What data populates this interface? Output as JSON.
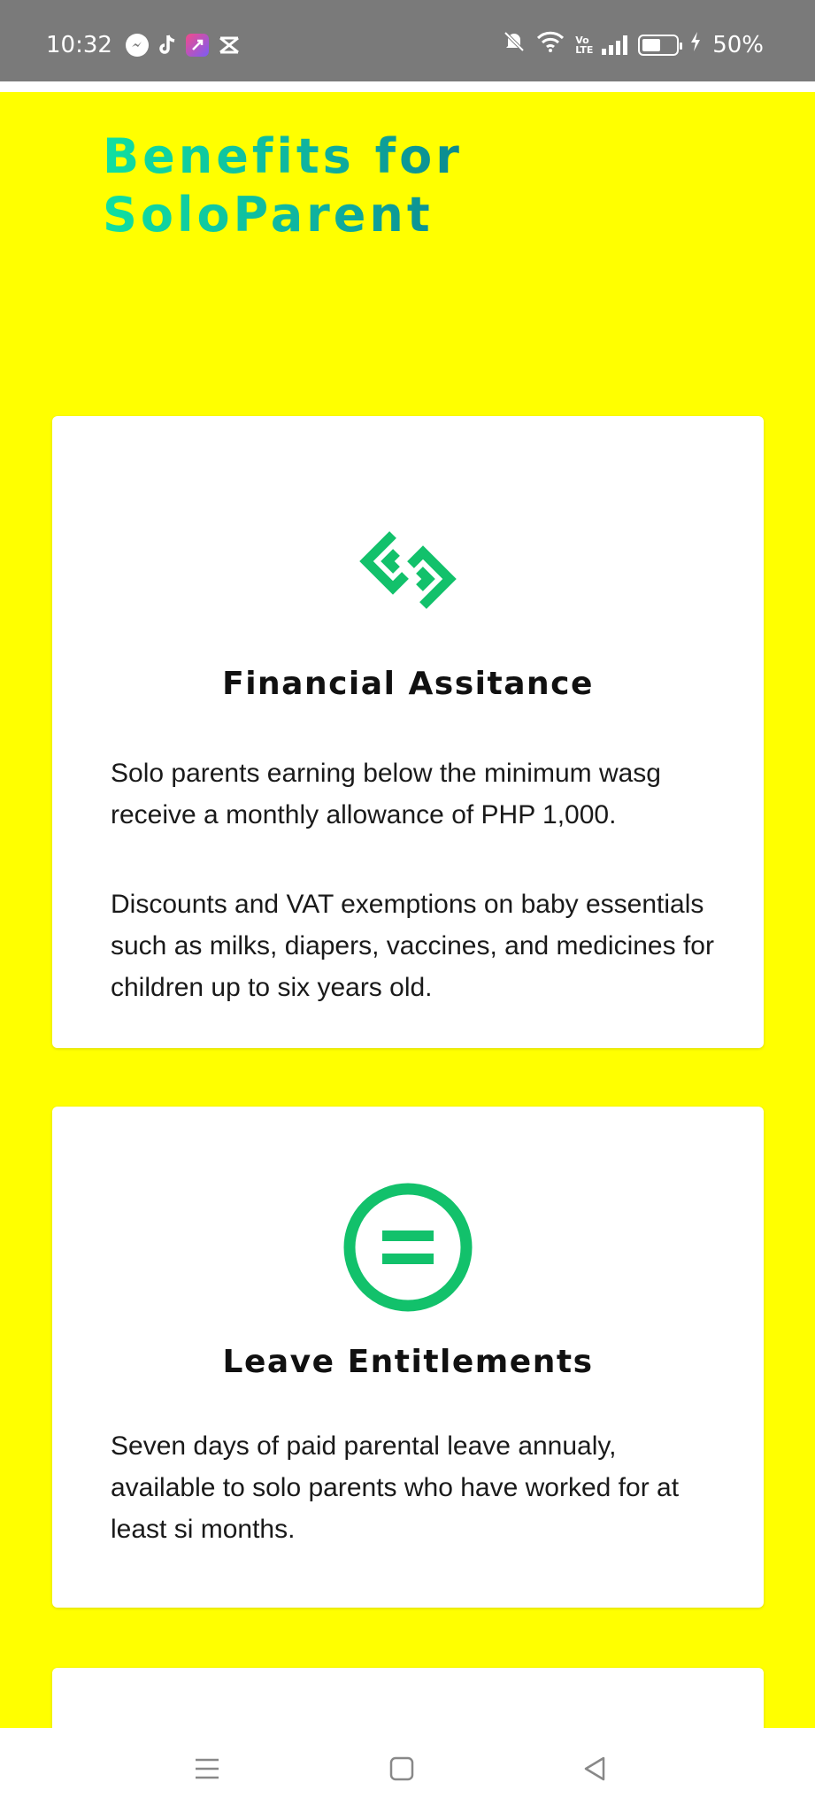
{
  "status_bar": {
    "time": "10:32",
    "app_icons": [
      "messenger-icon",
      "tiktok-icon",
      "app-icon",
      "capcut-icon"
    ],
    "network_label": "Vo LTE",
    "battery_percent": "50%",
    "battery_level": 0.5
  },
  "page": {
    "background_color": "#ffff00",
    "title": "Benefits for SoloParent",
    "title_line1": "Benefits for",
    "title_line2": "SoloParent"
  },
  "cards": [
    {
      "icon": "link-diamond-icon",
      "title": "Financial Assitance",
      "paragraphs": [
        "Solo parents earning below the minimum wasg receive a monthly allowance of PHP 1,000.",
        "Discounts and VAT exemptions on baby essentials such as milks, diapers, vaccines, and medicines for children up to six years old."
      ]
    },
    {
      "icon": "equals-circle-icon",
      "title": "Leave Entitlements",
      "paragraphs": [
        "Seven days of paid parental leave annualy, available to solo parents who have worked for at least si months."
      ]
    }
  ],
  "colors": {
    "accent_green": "#12c16b",
    "title_gradient_start": "#10e0a0",
    "title_gradient_end": "#0a6e86"
  },
  "nav_bar": {
    "buttons": [
      "menu-icon",
      "home-icon",
      "back-icon"
    ]
  }
}
